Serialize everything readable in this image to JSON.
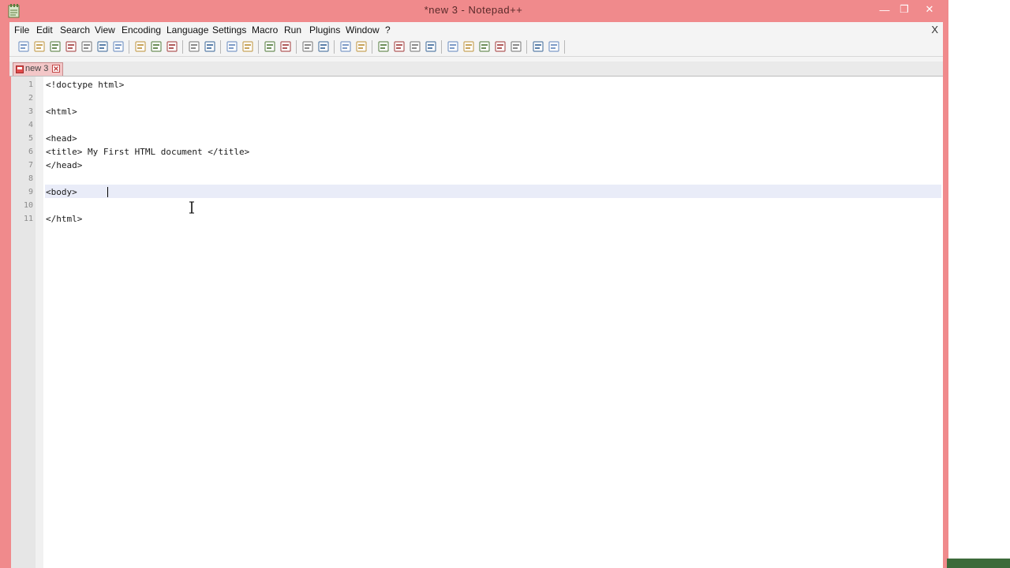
{
  "window": {
    "title": "*new 3 - Notepad++",
    "frame_color": "#f08a8c"
  },
  "window_controls": {
    "minimize": "—",
    "maximize": "❐",
    "close": "✕"
  },
  "menu": {
    "items": [
      "File",
      "Edit",
      "Search",
      "View",
      "Encoding",
      "Language",
      "Settings",
      "Macro",
      "Run",
      "Plugins",
      "Window",
      "?"
    ],
    "close_doc": "X"
  },
  "tab": {
    "label": "new 3",
    "accent": "#f3c7c8"
  },
  "editor": {
    "line_numbers": [
      "1",
      "2",
      "3",
      "4",
      "5",
      "6",
      "7",
      "8",
      "9",
      "10",
      "11"
    ],
    "lines": [
      "<!doctype html>",
      "",
      "<html>",
      "",
      "<head>",
      "<title> My First HTML document </title>",
      "</head>",
      "",
      "<body>",
      "",
      "</html>"
    ],
    "current_line_color": "#e9ecf8"
  },
  "toolbar": {
    "icons": [
      "new-file-icon",
      "open-file-icon",
      "save-icon",
      "save-all-icon",
      "close-icon",
      "close-all-icon",
      "print-icon",
      "cut-icon",
      "copy-icon",
      "paste-icon",
      "undo-icon",
      "redo-icon",
      "find-icon",
      "replace-icon",
      "zoom-in-icon",
      "zoom-out-icon",
      "sync-vertical-icon",
      "sync-horizontal-icon",
      "word-wrap-icon",
      "show-all-chars-icon",
      "indent-guide-icon",
      "user-language-icon",
      "doc-map-icon",
      "function-list-icon",
      "record-macro-icon",
      "stop-macro-icon",
      "play-macro-icon",
      "play-multiple-icon",
      "save-macro-icon",
      "document-list-icon",
      "monitoring-icon"
    ]
  }
}
